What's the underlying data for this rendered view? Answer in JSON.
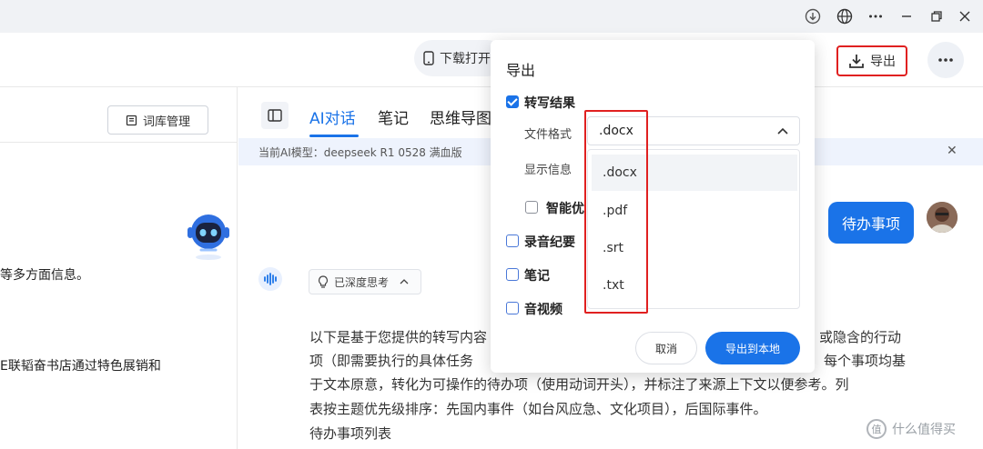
{
  "titlebar": {
    "icons": [
      "download-circle-icon",
      "globe-icon",
      "more-horizontal-icon",
      "minimize-icon",
      "restore-icon",
      "close-icon"
    ]
  },
  "header": {
    "download_label": "下载打开",
    "export_label": "导出"
  },
  "left_pane": {
    "vocab_button": "词库管理",
    "lines": [
      "等多方面信息。",
      "E联韬奋书店通过特色展销和"
    ]
  },
  "tabs": {
    "items": [
      "AI对话",
      "笔记",
      "思维导图"
    ],
    "active": "AI对话"
  },
  "model_bar": {
    "text": "当前AI模型：deepseek R1 0528 满血版"
  },
  "chat": {
    "user_message": "待办事项",
    "think_chip": "已深度思考",
    "ai_lines": [
      "以下是基于您提供的转写内容",
      "项（即需要执行的具体任务",
      "于文本原意，转化为可操作的待办项（使用动词开头），并标注了来源上下文以便参考。列",
      "表按主题优先级排序：先国内事件（如台风应急、文化项目），后国际事件。",
      "待办事项列表"
    ],
    "ai_right_fragments": [
      "或隐含的行动",
      "每个事项均基"
    ]
  },
  "export_popup": {
    "title": "导出",
    "transcript": {
      "label": "转写结果",
      "checked": true
    },
    "file_format_label": "文件格式",
    "file_format_value": ".docx",
    "display_info_label": "显示信息",
    "smart_label": "智能优",
    "options": [
      ".docx",
      ".pdf",
      ".srt",
      ".txt"
    ],
    "record_summary": {
      "label": "录音纪要",
      "checked": false
    },
    "notes": {
      "label": "笔记",
      "checked": false
    },
    "av": {
      "label": "音视频",
      "checked": false
    },
    "cancel_label": "取消",
    "export_local_label": "导出到本地"
  },
  "watermark": {
    "text": "什么值得买",
    "badge": "值"
  },
  "colors": {
    "accent": "#1a73e8",
    "highlight_frame": "#e02020",
    "model_bar_bg": "#eef3fd"
  }
}
